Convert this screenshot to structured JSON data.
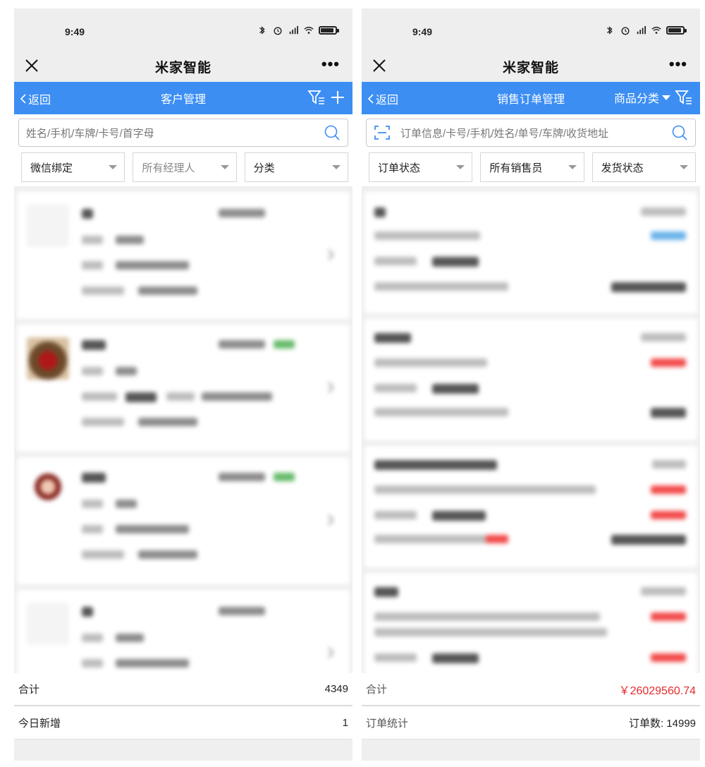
{
  "status_bar": {
    "time": "9:49"
  },
  "app": {
    "title": "米家智能"
  },
  "left": {
    "nav": {
      "back_label": "返回",
      "title": "客户管理"
    },
    "search": {
      "placeholder": "姓名/手机/车牌/卡号/首字母"
    },
    "filters": [
      "微信绑定",
      "所有经理人",
      "分类"
    ],
    "summary": [
      {
        "label": "合计",
        "value": "4349"
      },
      {
        "label": "今日新增",
        "value": "1"
      }
    ]
  },
  "right": {
    "nav": {
      "back_label": "返回",
      "title": "销售订单管理",
      "category_label": "商品分类"
    },
    "search": {
      "placeholder": "订单信息/卡号/手机/姓名/单号/车牌/收货地址"
    },
    "filters": [
      "订单状态",
      "所有销售员",
      "发货状态"
    ],
    "summary": [
      {
        "label": "合计",
        "value": "￥26029560.74"
      },
      {
        "label": "订单统计",
        "value": "订单数: 14999"
      }
    ]
  },
  "colors": {
    "nav_blue": "#3c8ef3",
    "total_red": "#e52b2b"
  },
  "icons": [
    "close-icon",
    "more-icon",
    "back-chevron-icon",
    "filter-icon",
    "add-icon",
    "search-icon",
    "scan-icon",
    "dropdown-caret-icon"
  ]
}
